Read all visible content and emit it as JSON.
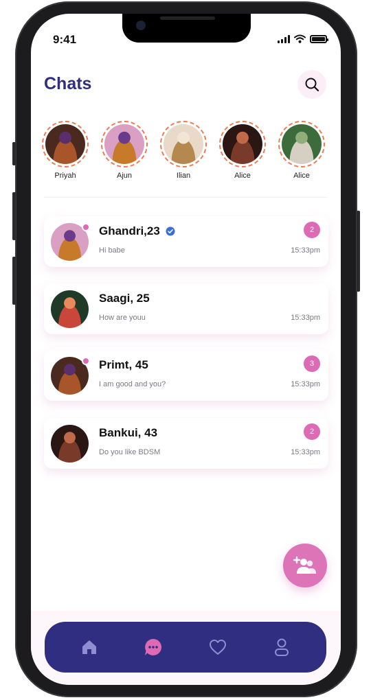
{
  "status_bar": {
    "time": "9:41"
  },
  "header": {
    "title": "Chats",
    "search_icon": "search-icon"
  },
  "stories": [
    {
      "name": "Priyah",
      "colors": [
        "#4a2a1f",
        "#a8552a",
        "#5b2f6e"
      ]
    },
    {
      "name": "Ajun",
      "colors": [
        "#d9a0c3",
        "#c77a2a",
        "#6a3b8a"
      ]
    },
    {
      "name": "Ilian",
      "colors": [
        "#e8d9c8",
        "#b5884f",
        "#f1e6d6"
      ]
    },
    {
      "name": "Alice",
      "colors": [
        "#2a1612",
        "#7a3a2a",
        "#c06a4a"
      ]
    },
    {
      "name": "Alice",
      "colors": [
        "#3c6b3c",
        "#d6d0c2",
        "#8fae7a"
      ]
    }
  ],
  "chats": [
    {
      "name": "Ghandri,23",
      "verified": true,
      "online": true,
      "preview": "Hi babe",
      "time": "15:33pm",
      "unread": "2",
      "colors": [
        "#d9a0c3",
        "#c77a2a",
        "#6a3b8a"
      ]
    },
    {
      "name": "Saagi, 25",
      "verified": false,
      "online": false,
      "preview": "How are youu",
      "time": "15:33pm",
      "unread": "",
      "colors": [
        "#203a28",
        "#c8463a",
        "#e98a5a"
      ]
    },
    {
      "name": "Primt, 45",
      "verified": false,
      "online": true,
      "preview": "I am good and you?",
      "time": "15:33pm",
      "unread": "3",
      "colors": [
        "#4a2a1f",
        "#a8552a",
        "#5b2f6e"
      ]
    },
    {
      "name": "Bankui, 43",
      "verified": false,
      "online": false,
      "preview": "Do you like BDSM",
      "time": "15:33pm",
      "unread": "2",
      "colors": [
        "#2a1612",
        "#7a3a2a",
        "#c06a4a"
      ]
    }
  ],
  "nav": [
    {
      "icon": "home-icon",
      "active": false
    },
    {
      "icon": "chat-icon",
      "active": true
    },
    {
      "icon": "heart-icon",
      "active": false
    },
    {
      "icon": "profile-icon",
      "active": false
    }
  ],
  "fab": {
    "icon": "add-friend-icon"
  },
  "colors": {
    "primary": "#2f2e80",
    "accent": "#dd6ab5",
    "nav_inactive": "#8e8ed0"
  }
}
